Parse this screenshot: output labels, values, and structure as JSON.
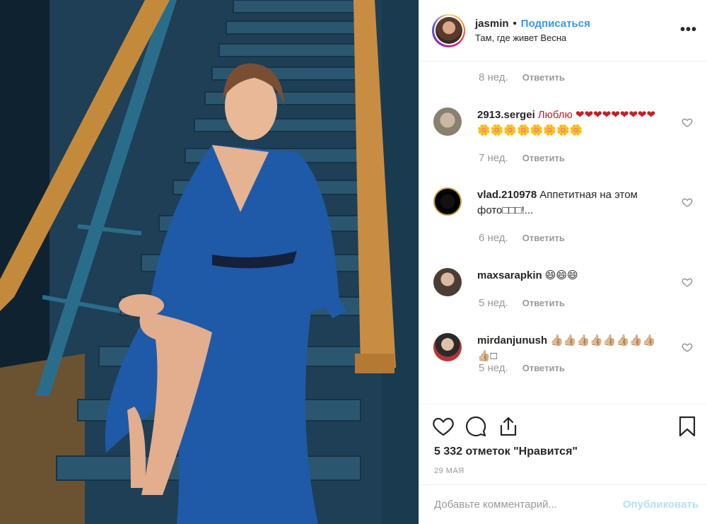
{
  "header": {
    "username": "jasmin",
    "separator": "•",
    "follow_label": "Подписаться",
    "location": "Там, где живет Весна",
    "more_label": "•••"
  },
  "comments": {
    "top_meta": {
      "time": "8 нед.",
      "reply": "Ответить"
    },
    "items": [
      {
        "user": "2913.sergei",
        "text": "Люблю ❤❤❤❤❤❤❤❤❤🌼🌼🌼🌼🌼🌼🌼🌼",
        "time": "7 нед.",
        "reply": "Ответить"
      },
      {
        "user": "vlad.210978",
        "text": "Аппетитная на этом фото□□□!...",
        "time": "6 нед.",
        "reply": "Ответить"
      },
      {
        "user": "maxsarapkin",
        "text": "😄😄😄",
        "time": "5 нед.",
        "reply": "Ответить"
      },
      {
        "user": "mirdanjunush",
        "text": "👍🏼👍🏼👍🏼👍🏼👍🏼👍🏼👍🏼👍🏼👍🏼□",
        "time": "5 нед.",
        "reply": "Ответить"
      }
    ]
  },
  "actions": {
    "likes_text": "5 332 отметок \"Нравится\"",
    "date": "29 МАЯ"
  },
  "add_comment": {
    "placeholder": "Добавьте комментарий...",
    "publish_label": "Опубликовать"
  },
  "colors": {
    "link_blue": "#3897f0",
    "publish_disabled": "#b2dffc",
    "muted": "#999999",
    "dress_blue": "#1f5aa8"
  }
}
